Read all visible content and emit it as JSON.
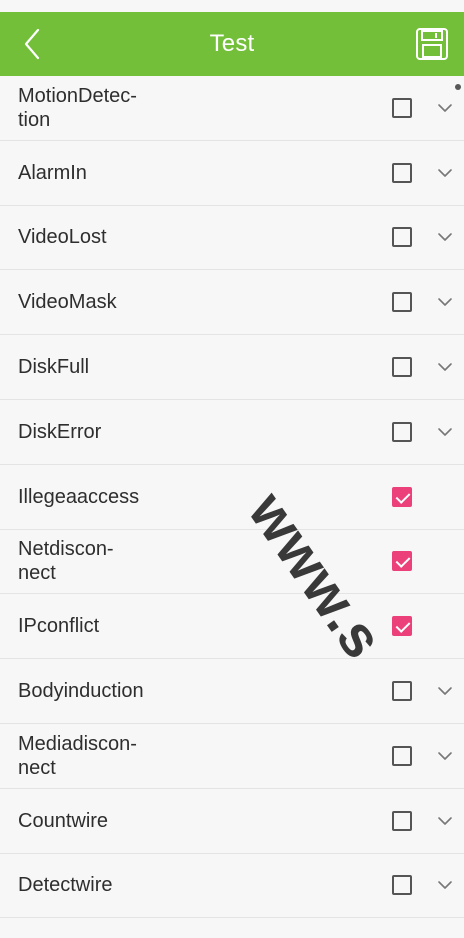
{
  "header": {
    "title": "Test",
    "back_icon": "chevron-left-icon",
    "save_icon": "floppy-save-icon",
    "bar_color": "#74bf3a"
  },
  "items": [
    {
      "label": "MotionDetec-\ntion",
      "checked": false,
      "expandable": true
    },
    {
      "label": "AlarmIn",
      "checked": false,
      "expandable": true
    },
    {
      "label": "VideoLost",
      "checked": false,
      "expandable": true
    },
    {
      "label": "VideoMask",
      "checked": false,
      "expandable": true
    },
    {
      "label": "DiskFull",
      "checked": false,
      "expandable": true
    },
    {
      "label": "DiskError",
      "checked": false,
      "expandable": true
    },
    {
      "label": "Illegeaaccess",
      "checked": true,
      "expandable": false
    },
    {
      "label": "Netdiscon-\nnect",
      "checked": true,
      "expandable": false
    },
    {
      "label": "IPconflict",
      "checked": true,
      "expandable": false
    },
    {
      "label": "Bodyinduction",
      "checked": false,
      "expandable": true
    },
    {
      "label": "Mediadiscon-\nnect",
      "checked": false,
      "expandable": true
    },
    {
      "label": "Countwire",
      "checked": false,
      "expandable": true
    },
    {
      "label": "Detectwire",
      "checked": false,
      "expandable": true
    }
  ],
  "colors": {
    "checked": "#ec407a",
    "unchecked": "#555555",
    "text": "#2e2e2e",
    "divider": "#e4e4e4"
  },
  "watermark": "www.s"
}
